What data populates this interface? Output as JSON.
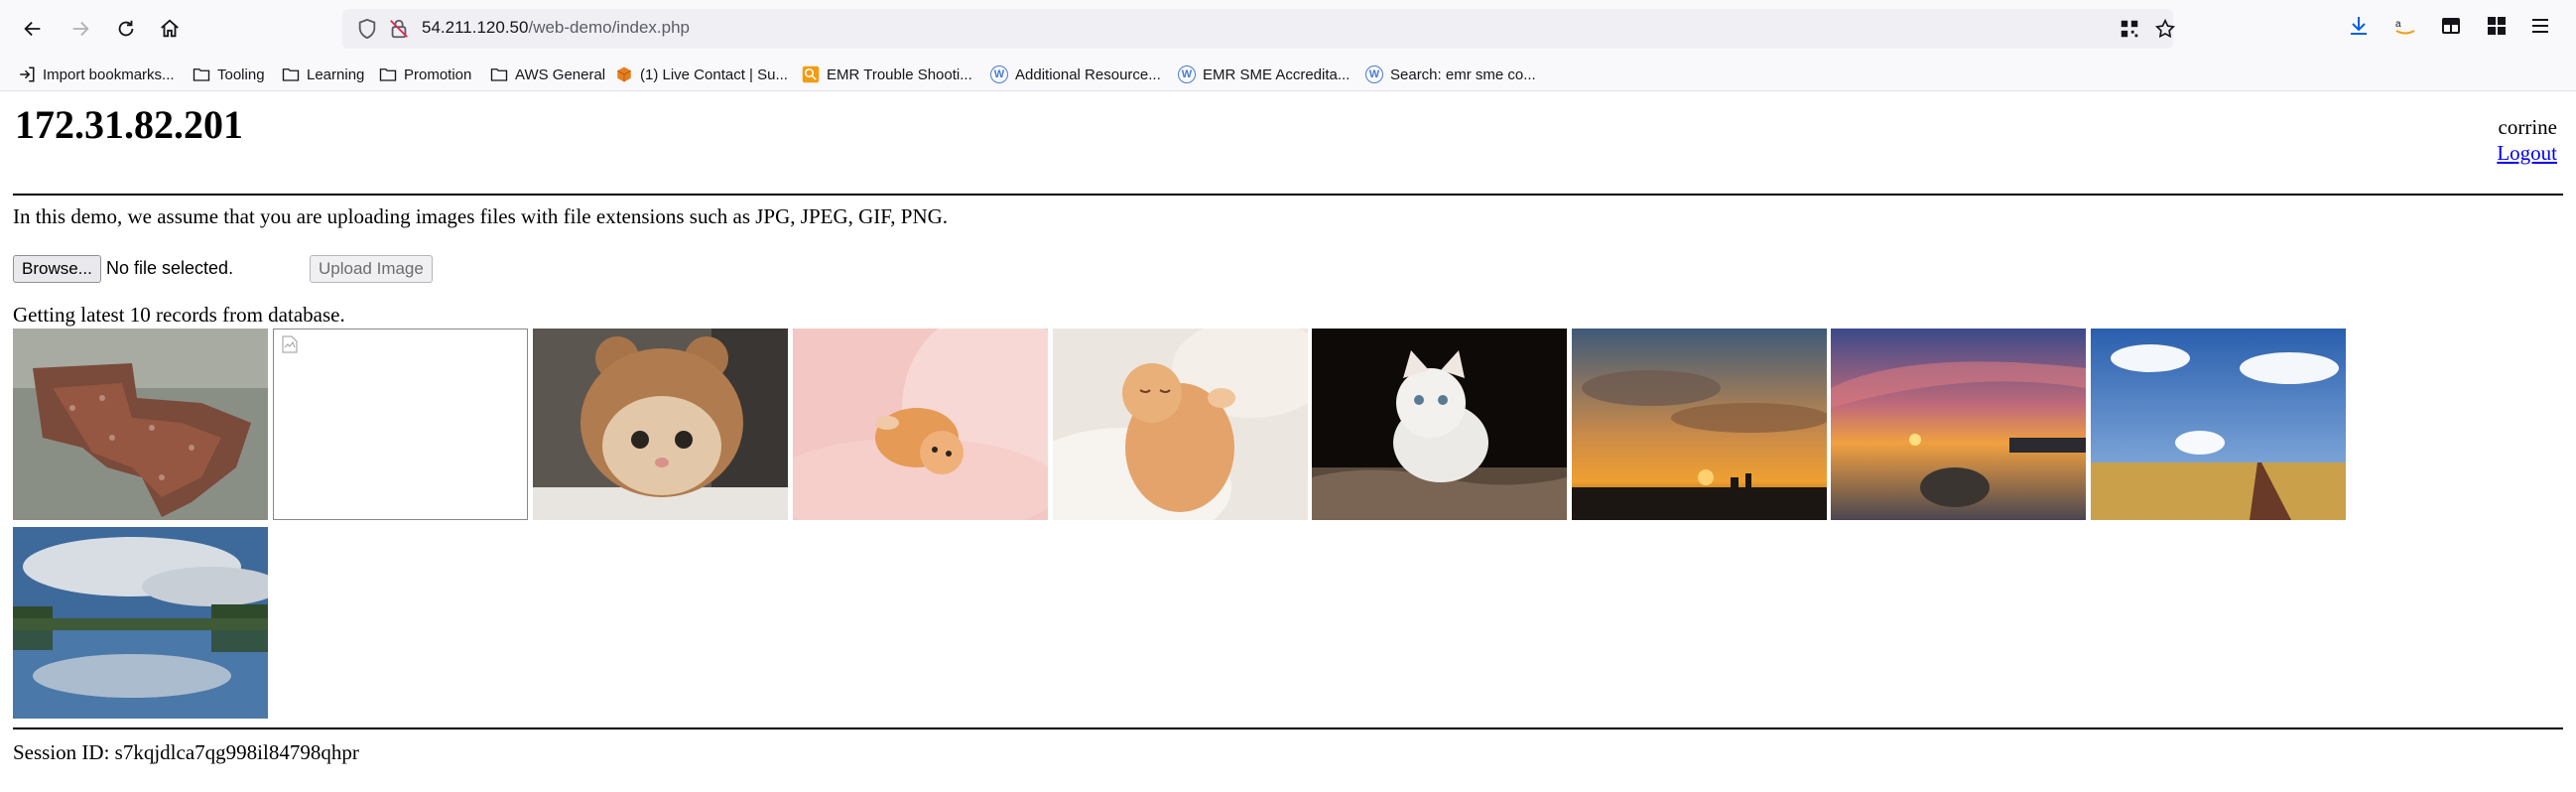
{
  "browser": {
    "url_host": "54.211.120.50",
    "url_path": "/web-demo/index.php",
    "bookmarks": [
      "Import bookmarks...",
      "Tooling",
      "Learning",
      "Promotion",
      "AWS General",
      "(1) Live Contact | Su...",
      "EMR Trouble Shooti...",
      "Additional Resource...",
      "EMR SME Accredita...",
      "Search: emr sme co..."
    ],
    "icons": {
      "back": "back-arrow-icon",
      "forward": "forward-arrow-icon",
      "reload": "reload-icon",
      "home": "home-icon",
      "downloads": "download-icon",
      "menu": "hamburger-menu-icon"
    },
    "colors": {
      "accent": "#0060df",
      "toolbar_bg": "#f9f9fb",
      "urlbar_bg": "#f0f0f4"
    }
  },
  "page": {
    "host_ip": "172.31.82.201",
    "username": "corrine",
    "logout_label": "Logout",
    "intro_text": "In this demo, we assume that you are uploading images files with file extensions such as JPG, JPEG, GIF, PNG.",
    "browse_label": "Browse...",
    "no_file_text": "No file selected.",
    "upload_label": "Upload Image",
    "records_text": "Getting latest 10 records from database.",
    "session_text": "Session ID: s7kqjdlca7qg998il84798qhpr",
    "link_color": "#0000ee",
    "images": [
      "crowd-map-photo",
      "broken-image",
      "kitten-bear-hat-photo",
      "kitten-pink-blanket-photo",
      "kitten-sleeping-photo",
      "white-kitten-photo",
      "sunset-city-photo",
      "sunset-beach-rock-photo",
      "blue-sky-field-road-photo",
      "lake-reflection-photo"
    ]
  }
}
